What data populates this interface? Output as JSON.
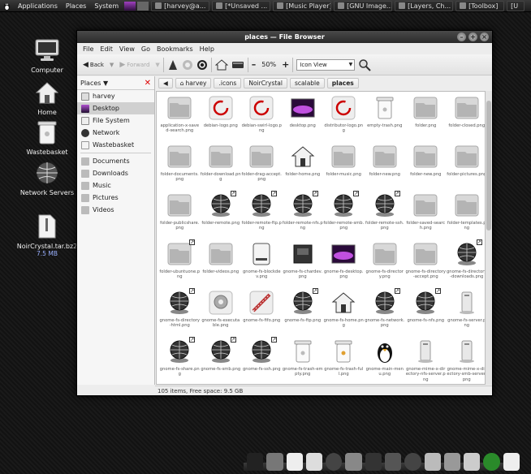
{
  "top_panel": {
    "menus": [
      "Applications",
      "Places",
      "System"
    ],
    "tasks": [
      "[harvey@a...",
      "[*Unsaved ...",
      "[Music Player]",
      "[GNU Image...",
      "[Layers, Ch...",
      "[Toolbox]"
    ],
    "trailing": "[U"
  },
  "desktop": {
    "icons": [
      {
        "label": "Computer",
        "icon": "computer-icon"
      },
      {
        "label": "Home",
        "icon": "home-icon"
      },
      {
        "label": "Wastebasket",
        "icon": "trash-icon"
      },
      {
        "label": "Network Servers",
        "icon": "network-icon"
      },
      {
        "label": "NoirCrystal.tar.bz2",
        "sub": "7.5 MB",
        "icon": "archive-icon"
      }
    ]
  },
  "window": {
    "title": "places — File Browser",
    "menus": [
      "File",
      "Edit",
      "View",
      "Go",
      "Bookmarks",
      "Help"
    ],
    "toolbar": {
      "back": "Back",
      "forward": "Forward",
      "zoom": "50%",
      "view_mode": "View Mode",
      "view_mode_value": "Icon View"
    },
    "sidebar": {
      "header": "Places",
      "items": [
        "harvey",
        "Desktop",
        "File System",
        "Network",
        "Wastebasket"
      ],
      "bookmarks": [
        "Documents",
        "Downloads",
        "Music",
        "Pictures",
        "Videos"
      ]
    },
    "path": [
      "harvey",
      ".icons",
      "NoirCrystal",
      "scalable",
      "places"
    ],
    "status": "105 items, Free space: 9.5 GB"
  },
  "files": [
    {
      "name": "application-x-saved-search.png",
      "kind": "folder"
    },
    {
      "name": "debian-logo.png",
      "kind": "debian"
    },
    {
      "name": "debian-swirl-logo.png",
      "kind": "debian"
    },
    {
      "name": "desktop.png",
      "kind": "desktop"
    },
    {
      "name": "distributor-logo.png",
      "kind": "debian"
    },
    {
      "name": "empty-trash.png",
      "kind": "trash"
    },
    {
      "name": "folder.png",
      "kind": "folder"
    },
    {
      "name": "folder-closed.png",
      "kind": "folder"
    },
    {
      "name": "folder-documents.png",
      "kind": "folder"
    },
    {
      "name": "folder-download.png",
      "kind": "folder"
    },
    {
      "name": "folder-drag-accept.png",
      "kind": "folder"
    },
    {
      "name": "folder-home.png",
      "kind": "home"
    },
    {
      "name": "folder-music.png",
      "kind": "folder"
    },
    {
      "name": "folder-new.png",
      "kind": "folder"
    },
    {
      "name": "folder-new.png",
      "kind": "folder"
    },
    {
      "name": "folder-pictures.png",
      "kind": "folder"
    },
    {
      "name": "folder-publicshare.png",
      "kind": "folder"
    },
    {
      "name": "folder-remote.png",
      "kind": "globe",
      "link": true
    },
    {
      "name": "folder-remote-ftp.png",
      "kind": "globe",
      "link": true
    },
    {
      "name": "folder-remote-nfs.png",
      "kind": "globe",
      "link": true
    },
    {
      "name": "folder-remote-smb.png",
      "kind": "globe",
      "link": true
    },
    {
      "name": "folder-remote-ssh.png",
      "kind": "globe",
      "link": true
    },
    {
      "name": "folder-saved-search.png",
      "kind": "folder"
    },
    {
      "name": "folder-templates.png",
      "kind": "folder"
    },
    {
      "name": "folder-ubuntuone.png",
      "kind": "folder",
      "link": true
    },
    {
      "name": "folder-videos.png",
      "kind": "folder"
    },
    {
      "name": "gnome-fs-blockdev.png",
      "kind": "drive"
    },
    {
      "name": "gnome-fs-chardev.png",
      "kind": "chip"
    },
    {
      "name": "gnome-fs-desktop.png",
      "kind": "desktop"
    },
    {
      "name": "gnome-fs-directory.png",
      "kind": "folder"
    },
    {
      "name": "gnome-fs-directory-accept.png",
      "kind": "folder"
    },
    {
      "name": "gnome-fs-directory-downloads.png",
      "kind": "globe",
      "link": true
    },
    {
      "name": "gnome-fs-directory-html.png",
      "kind": "globe",
      "link": true
    },
    {
      "name": "gnome-fs-executable.png",
      "kind": "gear"
    },
    {
      "name": "gnome-fs-fifo.png",
      "kind": "fifo"
    },
    {
      "name": "gnome-fs-ftp.png",
      "kind": "globe",
      "link": true
    },
    {
      "name": "gnome-fs-home.png",
      "kind": "home"
    },
    {
      "name": "gnome-fs-network.png",
      "kind": "globe",
      "link": true
    },
    {
      "name": "gnome-fs-nfs.png",
      "kind": "globe",
      "link": true
    },
    {
      "name": "gnome-fs-server.png",
      "kind": "server"
    },
    {
      "name": "gnome-fs-share.png",
      "kind": "globe",
      "link": true
    },
    {
      "name": "gnome-fs-smb.png",
      "kind": "globe",
      "link": true
    },
    {
      "name": "gnome-fs-ssh.png",
      "kind": "globe",
      "link": true
    },
    {
      "name": "gnome-fs-trash-empty.png",
      "kind": "trash"
    },
    {
      "name": "gnome-fs-trash-full.png",
      "kind": "trashfull"
    },
    {
      "name": "gnome-main-menu.png",
      "kind": "tux"
    },
    {
      "name": "gnome-mime-x-directory-nfs-server.png",
      "kind": "server"
    },
    {
      "name": "gnome-mime-x-directory-smb-server.png",
      "kind": "server"
    }
  ],
  "dock": {
    "icons": [
      "tux-icon",
      "desktop-icon",
      "document-icon",
      "folder-icon",
      "globe-icon",
      "speaker-icon",
      "rss-icon",
      "media-icon",
      "globe-icon",
      "gimp-icon",
      "pidgin-icon",
      "trash-icon",
      "power-icon",
      "trash-full-icon"
    ]
  }
}
